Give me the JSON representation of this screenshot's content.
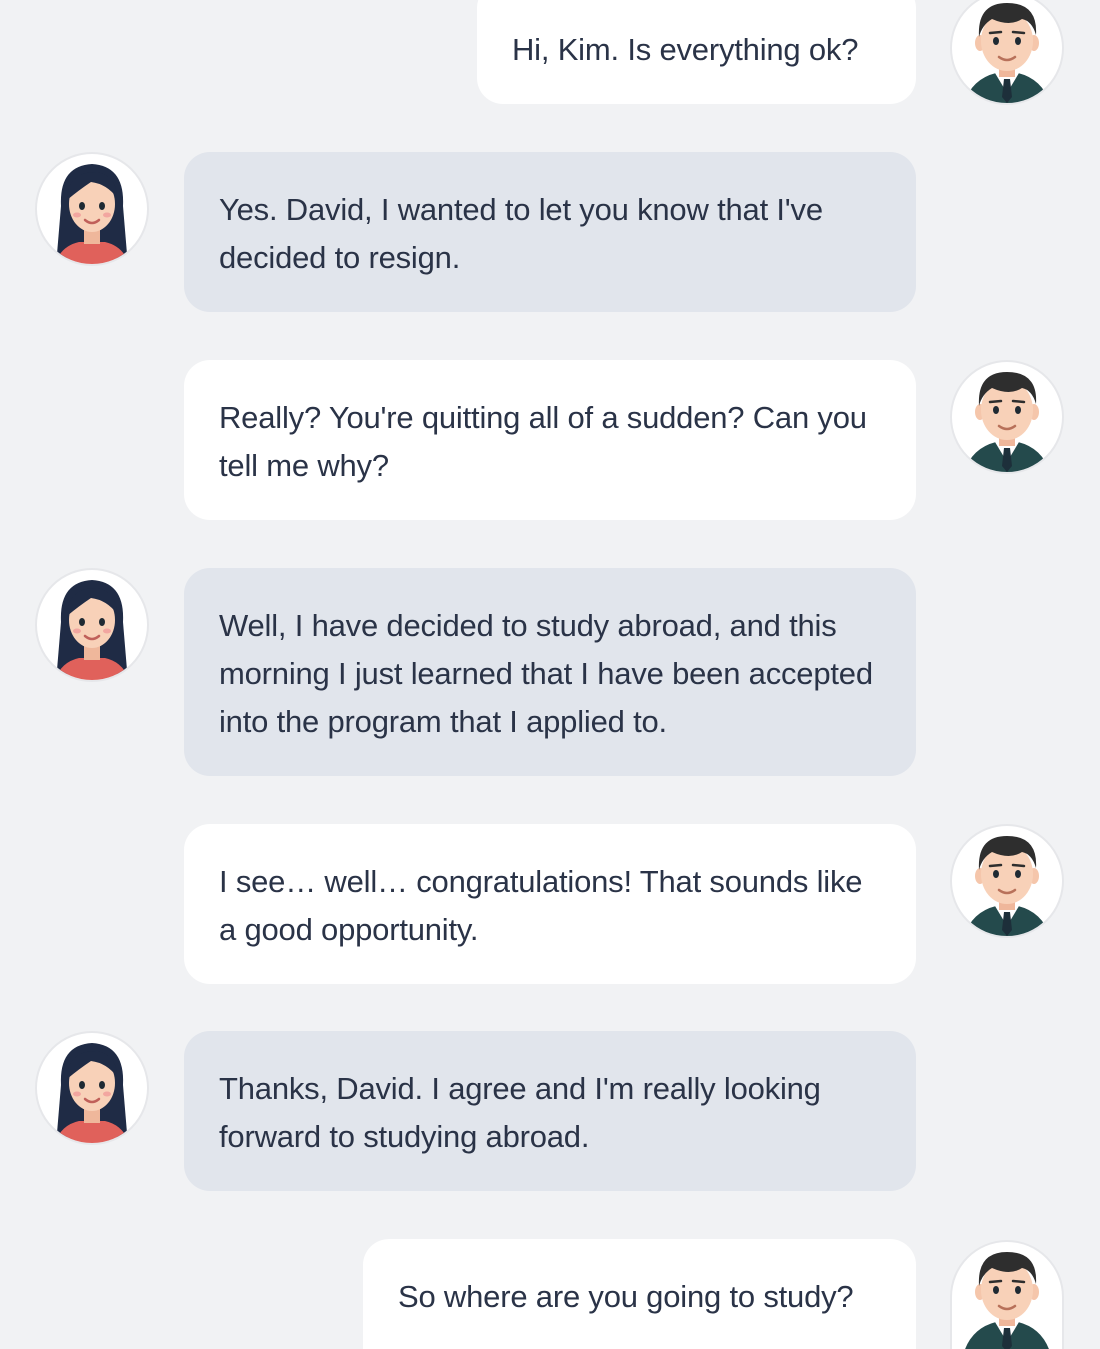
{
  "conversation": {
    "participants": {
      "david": {
        "name": "David",
        "avatar_icon": "male-avatar-icon"
      },
      "kim": {
        "name": "Kim",
        "avatar_icon": "female-avatar-icon"
      }
    },
    "messages": [
      {
        "sender": "david",
        "text": "Hi, Kim. Is everything ok?"
      },
      {
        "sender": "kim",
        "text": "Yes. David, I wanted to let you know that I've decided to resign."
      },
      {
        "sender": "david",
        "text": "Really? You're quitting all of a sudden? Can you tell me why?"
      },
      {
        "sender": "kim",
        "text": "Well, I have decided to study abroad, and this morning I just learned that I have been accepted into the program that I applied to."
      },
      {
        "sender": "david",
        "text": "I see… well… congratulations! That sounds like a good opportunity."
      },
      {
        "sender": "kim",
        "text": "Thanks, David. I agree and I'm really looking forward to studying abroad."
      },
      {
        "sender": "david",
        "text": "So where are you going to study?"
      }
    ]
  },
  "colors": {
    "background": "#f1f2f4",
    "david_bubble": "#ffffff",
    "kim_bubble": "#e1e5ec",
    "text": "#2a3347"
  }
}
